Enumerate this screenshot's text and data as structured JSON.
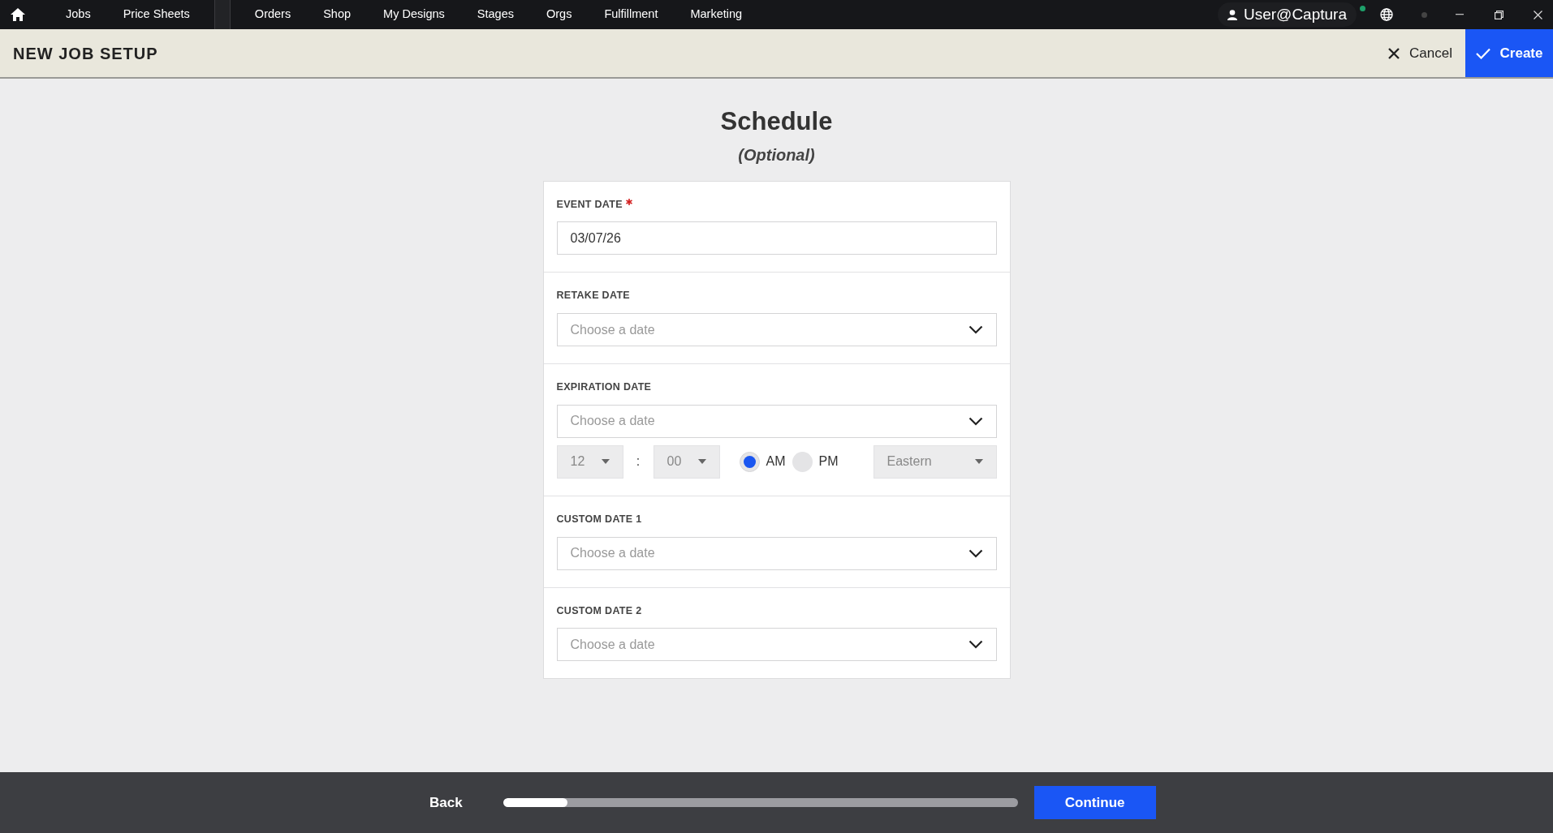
{
  "nav": {
    "items": [
      {
        "label": "Jobs"
      },
      {
        "label": "Price Sheets"
      },
      {
        "label": "Orders"
      },
      {
        "label": "Shop"
      },
      {
        "label": "My Designs"
      },
      {
        "label": "Stages"
      },
      {
        "label": "Orgs"
      },
      {
        "label": "Fulfillment"
      },
      {
        "label": "Marketing"
      }
    ],
    "user": "User@Captura"
  },
  "header": {
    "title": "NEW JOB SETUP",
    "cancel": "Cancel",
    "create": "Create"
  },
  "page": {
    "title": "Schedule",
    "subtitle": "(Optional)"
  },
  "sections": [
    {
      "kind": "text",
      "label": "EVENT DATE",
      "required": true,
      "value": "03/07/26"
    },
    {
      "kind": "date",
      "label": "RETAKE DATE",
      "required": false,
      "placeholder": "Choose a date"
    },
    {
      "kind": "datetime",
      "label": "EXPIRATION DATE",
      "required": false,
      "placeholder": "Choose a date",
      "hour": "12",
      "separator": ":",
      "minute": "00",
      "periods": [
        {
          "label": "AM",
          "selected": true
        },
        {
          "label": "PM",
          "selected": false
        }
      ],
      "timezone": "Eastern"
    },
    {
      "kind": "date",
      "label": "CUSTOM DATE 1",
      "required": false,
      "placeholder": "Choose a date"
    },
    {
      "kind": "date",
      "label": "CUSTOM DATE 2",
      "required": false,
      "placeholder": "Choose a date"
    }
  ],
  "footer": {
    "back": "Back",
    "progress": {
      "level": 0.125
    },
    "continue": "Continue"
  }
}
